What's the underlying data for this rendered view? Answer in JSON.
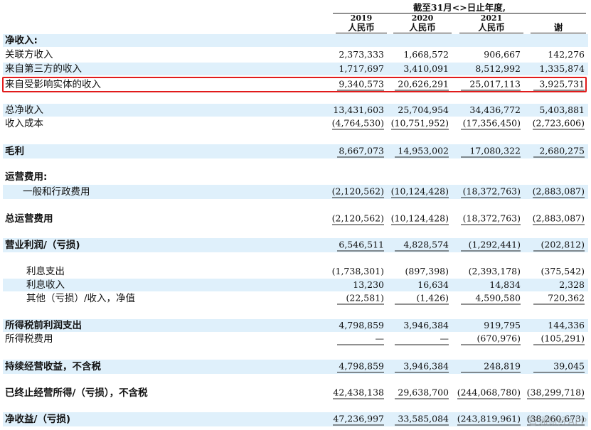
{
  "header": {
    "period": "截至31月<>日止年度,",
    "years": [
      "2019",
      "2020",
      "2021",
      ""
    ],
    "currencies": [
      "人民币",
      "人民币",
      "人民币",
      "谢"
    ]
  },
  "rows": [
    {
      "label": "净收入:",
      "bold": true,
      "values": [
        "",
        "",
        "",
        ""
      ]
    },
    {
      "label": "关联方收入",
      "values": [
        "2,373,333",
        "1,668,572",
        "906,667",
        "142,276"
      ]
    },
    {
      "label": "来自第三方的收入",
      "values": [
        "1,717,697",
        "3,410,091",
        "8,512,992",
        "1,335,874"
      ]
    },
    {
      "label": "来自受影响实体的收入",
      "values": [
        "9,340,573",
        "20,626,291",
        "25,017,113",
        "3,925,731"
      ]
    },
    {
      "label": "总净收入",
      "values": [
        "13,431,603",
        "25,704,954",
        "34,436,772",
        "5,403,881"
      ]
    },
    {
      "label": "收入成本",
      "values": [
        "(4,764,530)",
        "(10,751,952)",
        "(17,356,450)",
        "(2,723,606)"
      ]
    },
    {
      "label": "毛利",
      "bold": true,
      "values": [
        "8,667,073",
        "14,953,002",
        "17,080,322",
        "2,680,275"
      ]
    },
    {
      "label": "运营费用:",
      "bold": true,
      "values": [
        "",
        "",
        "",
        ""
      ]
    },
    {
      "label": "一般和行政费用",
      "values": [
        "(2,120,562)",
        "(10,124,428)",
        "(18,372,763)",
        "(2,883,087)"
      ]
    },
    {
      "label": "总运营费用",
      "bold": true,
      "values": [
        "(2,120,562)",
        "(10,124,428)",
        "(18,372,763)",
        "(2,883,087)"
      ]
    },
    {
      "label": "营业利润/（亏损)",
      "bold": true,
      "values": [
        "6,546,511",
        "4,828,574",
        "(1,292,441)",
        "(202,812)"
      ]
    },
    {
      "label": "利息支出",
      "values": [
        "(1,738,301)",
        "(897,398)",
        "(2,393,178)",
        "(375,542)"
      ]
    },
    {
      "label": "利息收入",
      "values": [
        "13,230",
        "16,634",
        "14,834",
        "2,328"
      ]
    },
    {
      "label": "其他（亏损）/收入，净值",
      "values": [
        "(22,581)",
        "(1,426)",
        "4,590,580",
        "720,362"
      ]
    },
    {
      "label": "所得税前利润支出",
      "bold": true,
      "values": [
        "4,798,859",
        "3,946,384",
        "919,795",
        "144,336"
      ]
    },
    {
      "label": "所得税费用",
      "values": [
        "—",
        "—",
        "(670,976)",
        "(105,291)"
      ]
    },
    {
      "label": "持续经营收益，不含税",
      "bold": true,
      "values": [
        "4,798,859",
        "3,946,384",
        "248,819",
        "39,045"
      ]
    },
    {
      "label": "已终止经营所得/（亏损），不含税",
      "bold": true,
      "values": [
        "42,438,138",
        "29,638,700",
        "(244,068,780)",
        "(38,299,718)"
      ]
    },
    {
      "label": "净收益/（亏损)",
      "bold": true,
      "values": [
        "47,236,997",
        "33,585,084",
        "(243,819,961)",
        "(38,260,673)"
      ]
    }
  ],
  "watermark": "智通财经APP",
  "highlight_color": "#e11b1b",
  "band_color": "#dff0fb"
}
